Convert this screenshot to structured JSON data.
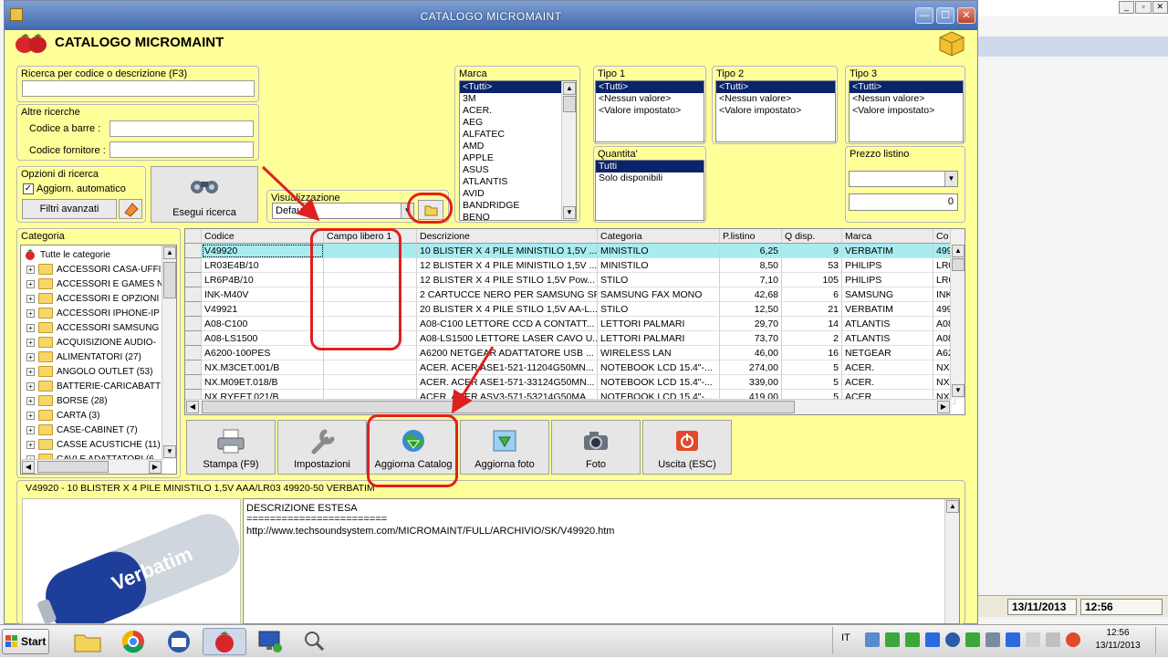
{
  "window": {
    "title": "CATALOGO MICROMAINT",
    "header_title": "CATALOGO MICROMAINT",
    "min": "—",
    "max": "☐",
    "close": "✕"
  },
  "bg_app": {
    "date": "13/11/2013",
    "time": "12:56"
  },
  "search": {
    "title": "Ricerca per codice o descrizione (F3)",
    "value": ""
  },
  "altre": {
    "title": "Altre ricerche",
    "barcode_label": "Codice a barre :",
    "supplier_label": "Codice fornitore :"
  },
  "options": {
    "title": "Opzioni di ricerca",
    "auto_update_label": "Aggiorn. automatico",
    "auto_update_checked": true,
    "advanced_filters": "Filtri avanzati"
  },
  "run_search": "Esegui ricerca",
  "view": {
    "title": "Visualizzazione",
    "value": "Default"
  },
  "brand": {
    "title": "Marca",
    "items": [
      "<Tutti>",
      "3M",
      "ACER.",
      "AEG",
      "ALFATEC",
      "AMD",
      "APPLE",
      "ASUS",
      "ATLANTIS",
      "AVID",
      "BANDRIDGE",
      "BENQ"
    ]
  },
  "tipo1": {
    "title": "Tipo 1",
    "items": [
      "<Tutti>",
      "<Nessun valore>",
      "<Valore impostato>"
    ]
  },
  "tipo2": {
    "title": "Tipo 2",
    "items": [
      "<Tutti>",
      "<Nessun valore>",
      "<Valore impostato>"
    ]
  },
  "tipo3": {
    "title": "Tipo 3",
    "items": [
      "<Tutti>",
      "<Nessun valore>",
      "<Valore impostato>"
    ]
  },
  "quantity": {
    "title": "Quantita'",
    "items": [
      "Tutti",
      "Solo disponibili"
    ]
  },
  "price": {
    "title": "Prezzo listino",
    "value": "0"
  },
  "category": {
    "title": "Categoria",
    "root": "Tutte le categorie",
    "items": [
      "ACCESSORI CASA-UFFI",
      "ACCESSORI E GAMES N",
      "ACCESSORI E OPZIONI",
      "ACCESSORI IPHONE-IP",
      "ACCESSORI SAMSUNG",
      "ACQUISIZIONE AUDIO-",
      "ALIMENTATORI (27)",
      "ANGOLO OUTLET (53)",
      "BATTERIE-CARICABATT",
      "BORSE (28)",
      "CARTA (3)",
      "CASE-CABINET (7)",
      "CASSE ACUSTICHE (11)",
      "CAVI E ADATTATORI (6"
    ]
  },
  "grid": {
    "columns": [
      "Codice",
      "Campo libero 1",
      "Descrizione",
      "Categoria",
      "P.listino",
      "Q disp.",
      "Marca",
      "Co"
    ],
    "rows": [
      [
        "V49920",
        "",
        "10 BLISTER X 4 PILE MINISTILO 1,5V ...",
        "MINISTILO",
        "6,25",
        "9",
        "VERBATIM",
        "499"
      ],
      [
        "LR03E4B/10",
        "",
        "12 BLISTER X 4 PILE MINISTILO 1,5V ...",
        "MINISTILO",
        "8,50",
        "53",
        "PHILIPS",
        "LR0"
      ],
      [
        "LR6P4B/10",
        "",
        "12 BLISTER X 4 PILE STILO 1,5V Pow...",
        "STILO",
        "7,10",
        "105",
        "PHILIPS",
        "LR6"
      ],
      [
        "INK-M40V",
        "",
        "2 CARTUCCE NERO PER SAMSUNG SF...",
        "SAMSUNG FAX MONO",
        "42,68",
        "6",
        "SAMSUNG",
        "INK"
      ],
      [
        "V49921",
        "",
        "20 BLISTER X 4 PILE STILO 1,5V AA-L...",
        "STILO",
        "12,50",
        "21",
        "VERBATIM",
        "499"
      ],
      [
        "A08-C100",
        "",
        "A08-C100 LETTORE CCD A CONTATT...",
        "LETTORI PALMARI",
        "29,70",
        "14",
        "ATLANTIS",
        "A08"
      ],
      [
        "A08-LS1500",
        "",
        "A08-LS1500 LETTORE LASER CAVO U...",
        "LETTORI PALMARI",
        "73,70",
        "2",
        "ATLANTIS",
        "A08"
      ],
      [
        "A6200-100PES",
        "",
        "A6200 NETGEAR ADATTATORE USB ...",
        "WIRELESS LAN",
        "46,00",
        "16",
        "NETGEAR",
        "A62"
      ],
      [
        "NX.M3CET.001/B",
        "",
        "ACER. ACER ASE1-521-11204G50MN...",
        "NOTEBOOK LCD 15.4\"-...",
        "274,00",
        "5",
        "ACER.",
        "NX."
      ],
      [
        "NX.M09ET.018/B",
        "",
        "ACER. ACER ASE1-571-33124G50MN...",
        "NOTEBOOK LCD 15.4\"-...",
        "339,00",
        "5",
        "ACER.",
        "NX."
      ],
      [
        "NX.RYEET.021/B",
        "",
        "ACER. ACER ASV3-571-53214G50MA...",
        "NOTEBOOK LCD 15.4\"-...",
        "419,00",
        "5",
        "ACER.",
        "NX."
      ]
    ]
  },
  "toolbar": {
    "print": "Stampa (F9)",
    "settings": "Impostazioni",
    "update_catalog": "Aggiorna Catalog",
    "update_photo": "Aggiorna foto",
    "photo": "Foto",
    "exit": "Uscita (ESC)"
  },
  "detail": {
    "title": "V49920 - 10 BLISTER X 4 PILE MINISTILO 1,5V AAA/LR03 49920-50 VERBATIM",
    "heading": "DESCRIZIONE ESTESA",
    "separator": "========================",
    "url": "http://www.techsoundsystem.com/MICROMAINT/FULL/ARCHIVIO/SK/V49920.htm",
    "image_brand": "Verbatim"
  },
  "taskbar": {
    "start": "Start",
    "lang": "IT",
    "time": "12:56",
    "date": "13/11/2013"
  }
}
